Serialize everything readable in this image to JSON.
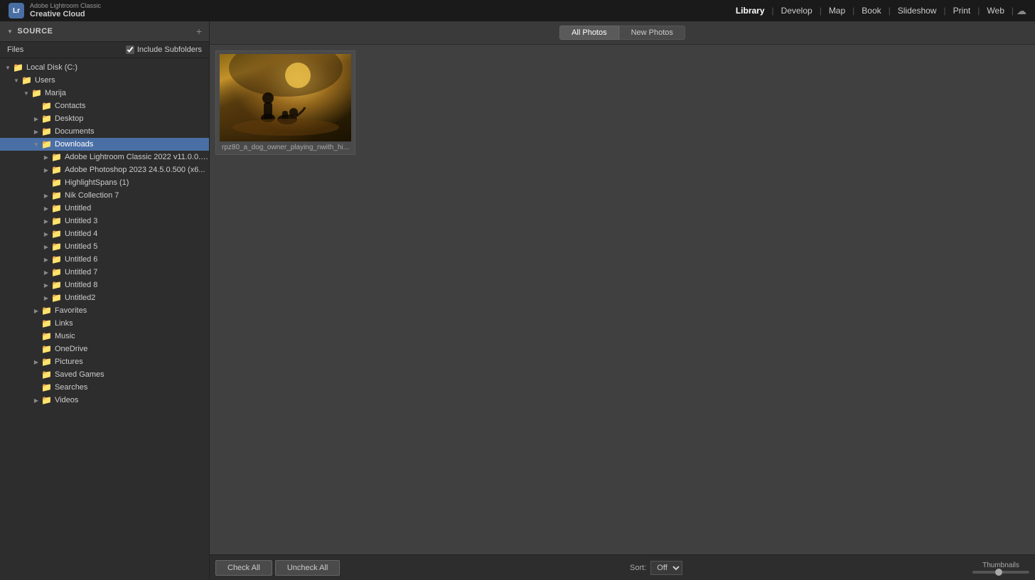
{
  "app": {
    "logo": "Lr",
    "name_top": "Adobe Lightroom Classic",
    "name_bottom": "Creative Cloud"
  },
  "top_nav": {
    "items": [
      {
        "label": "Library",
        "active": true
      },
      {
        "label": "Develop",
        "active": false
      },
      {
        "label": "Map",
        "active": false
      },
      {
        "label": "Book",
        "active": false
      },
      {
        "label": "Slideshow",
        "active": false
      },
      {
        "label": "Print",
        "active": false
      },
      {
        "label": "Web",
        "active": false
      }
    ]
  },
  "sidebar": {
    "title": "Source",
    "files_label": "Files",
    "include_subfolders_label": "Include Subfolders",
    "include_subfolders_checked": true,
    "tree": {
      "disk_label": "Local Disk (C:)",
      "disk_expanded": true,
      "users_label": "Users",
      "users_expanded": true,
      "marija_label": "Marija",
      "marija_expanded": true,
      "folders": [
        {
          "label": "Contacts",
          "depth": 3,
          "expandable": false,
          "expanded": false
        },
        {
          "label": "Desktop",
          "depth": 3,
          "expandable": true,
          "expanded": false
        },
        {
          "label": "Documents",
          "depth": 3,
          "expandable": true,
          "expanded": false
        },
        {
          "label": "Downloads",
          "depth": 3,
          "expandable": true,
          "expanded": true,
          "selected": true,
          "children": [
            {
              "label": "Adobe Lightroom Classic 2022 v11.0.0.1...",
              "depth": 5,
              "expandable": true,
              "expanded": false
            },
            {
              "label": "Adobe Photoshop 2023 24.5.0.500 (x6...",
              "depth": 5,
              "expandable": true,
              "expanded": false
            },
            {
              "label": "HighlightSpans (1)",
              "depth": 5,
              "expandable": false,
              "expanded": false
            },
            {
              "label": "Nik Collection 7",
              "depth": 5,
              "expandable": true,
              "expanded": false
            },
            {
              "label": "Untitled",
              "depth": 5,
              "expandable": true,
              "expanded": false
            },
            {
              "label": "Untitled 3",
              "depth": 5,
              "expandable": true,
              "expanded": false
            },
            {
              "label": "Untitled 4",
              "depth": 5,
              "expandable": true,
              "expanded": false
            },
            {
              "label": "Untitled 5",
              "depth": 5,
              "expandable": true,
              "expanded": false
            },
            {
              "label": "Untitled 6",
              "depth": 5,
              "expandable": true,
              "expanded": false
            },
            {
              "label": "Untitled 7",
              "depth": 5,
              "expandable": true,
              "expanded": false
            },
            {
              "label": "Untitled 8",
              "depth": 5,
              "expandable": true,
              "expanded": false
            },
            {
              "label": "Untitled2",
              "depth": 5,
              "expandable": true,
              "expanded": false
            }
          ]
        },
        {
          "label": "Favorites",
          "depth": 3,
          "expandable": true,
          "expanded": false
        },
        {
          "label": "Links",
          "depth": 3,
          "expandable": false,
          "expanded": false
        },
        {
          "label": "Music",
          "depth": 3,
          "expandable": false,
          "expanded": false
        },
        {
          "label": "OneDrive",
          "depth": 3,
          "expandable": false,
          "expanded": false
        },
        {
          "label": "Pictures",
          "depth": 3,
          "expandable": true,
          "expanded": false
        },
        {
          "label": "Saved Games",
          "depth": 3,
          "expandable": false,
          "expanded": false
        },
        {
          "label": "Searches",
          "depth": 3,
          "expandable": false,
          "expanded": false
        },
        {
          "label": "Videos",
          "depth": 3,
          "expandable": true,
          "expanded": false
        }
      ]
    }
  },
  "photo_tabs": {
    "all_photos": "All Photos",
    "new_photos": "New Photos",
    "active": "All Photos"
  },
  "grid": {
    "photos": [
      {
        "filename": "rpz80_a_dog_owner_playing_nwith_hi...",
        "checked": true
      }
    ]
  },
  "bottom_bar": {
    "check_all": "Check All",
    "uncheck_all": "Uncheck All",
    "sort_label": "Sort:",
    "sort_value": "Off",
    "thumbnails_label": "Thumbnails"
  }
}
